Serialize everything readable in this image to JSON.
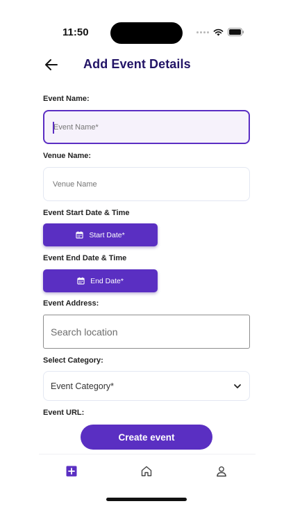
{
  "status_bar": {
    "time": "11:50"
  },
  "header": {
    "title": "Add Event Details"
  },
  "form": {
    "event_name": {
      "label": "Event Name:",
      "placeholder": "Event Name*",
      "value": ""
    },
    "venue_name": {
      "label": "Venue Name:",
      "placeholder": "Venue Name",
      "value": ""
    },
    "start_date": {
      "label": "Event Start Date & Time",
      "button_label": "Start Date*"
    },
    "end_date": {
      "label": "Event End Date & Time",
      "button_label": "End Date*"
    },
    "address": {
      "label": "Event Address:",
      "placeholder": "Search location",
      "value": ""
    },
    "category": {
      "label": "Select Category:",
      "selected": "Event Category*"
    },
    "url": {
      "label": "Event URL:"
    },
    "submit_label": "Create event"
  },
  "bottom_nav": {
    "items": [
      {
        "icon": "add-square-icon",
        "active": true
      },
      {
        "icon": "home-icon",
        "active": false
      },
      {
        "icon": "profile-icon",
        "active": false
      }
    ]
  },
  "colors": {
    "accent": "#5a2fc2",
    "title": "#221466",
    "active_input_bg": "#f6f2fb",
    "input_border": "#e3e7f2"
  }
}
